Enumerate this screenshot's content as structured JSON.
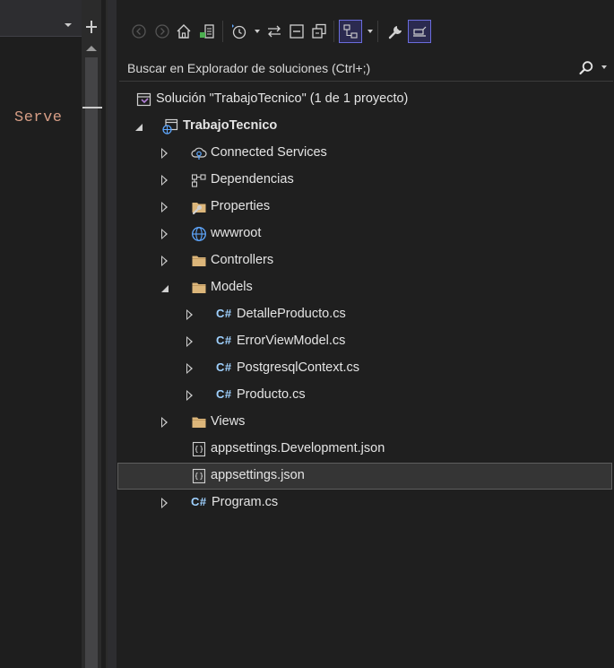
{
  "editor": {
    "visible_text": "Serve"
  },
  "toolbar": {
    "buttons": [
      {
        "icon": "back-icon"
      },
      {
        "icon": "forward-icon"
      },
      {
        "icon": "home-icon"
      },
      {
        "icon": "switch-views-icon"
      },
      {
        "icon": "pending-changes-filter-icon"
      },
      {
        "icon": "sync-with-active-document-icon"
      },
      {
        "icon": "collapse-all-icon"
      },
      {
        "icon": "show-all-files-icon"
      },
      {
        "icon": "preview-selected-items-icon",
        "active": true
      },
      {
        "icon": "properties-wrench-icon"
      },
      {
        "icon": "preview-pane-icon",
        "active": true
      }
    ]
  },
  "search": {
    "placeholder": "Buscar en Explorador de soluciones (Ctrl+;)"
  },
  "tree": {
    "solution": {
      "label": "Solución \"TrabajoTecnico\"  (1 de 1 proyecto)"
    },
    "project": {
      "label": "TrabajoTecnico",
      "expanded": true
    },
    "items": [
      {
        "label": "Connected Services",
        "icon": "connected-services-icon",
        "expanded": false
      },
      {
        "label": "Dependencias",
        "icon": "dependencies-icon",
        "expanded": false
      },
      {
        "label": "Properties",
        "icon": "properties-folder-icon",
        "expanded": false
      },
      {
        "label": "wwwroot",
        "icon": "globe-icon",
        "expanded": false
      },
      {
        "label": "Controllers",
        "icon": "folder-icon",
        "expanded": false
      },
      {
        "label": "Models",
        "icon": "folder-icon",
        "expanded": true
      },
      {
        "label": "DetalleProducto.cs",
        "icon": "csharp-file-icon",
        "expanded": false
      },
      {
        "label": "ErrorViewModel.cs",
        "icon": "csharp-file-icon",
        "expanded": false
      },
      {
        "label": "PostgresqlContext.cs",
        "icon": "csharp-file-icon",
        "expanded": false
      },
      {
        "label": "Producto.cs",
        "icon": "csharp-file-icon",
        "expanded": false
      },
      {
        "label": "Views",
        "icon": "folder-icon",
        "expanded": false
      },
      {
        "label": "appsettings.Development.json",
        "icon": "json-file-icon"
      },
      {
        "label": "appsettings.json",
        "icon": "json-file-icon",
        "selected": true
      },
      {
        "label": "Program.cs",
        "icon": "csharp-file-icon",
        "expanded": false
      }
    ],
    "csharp_glyph": "C#"
  },
  "colors": {
    "background": "#1f1f1f",
    "selection": "#353535",
    "folder": "#dcb67a",
    "csharp": "#9fd1ff",
    "accent": "#6a6cdd"
  }
}
